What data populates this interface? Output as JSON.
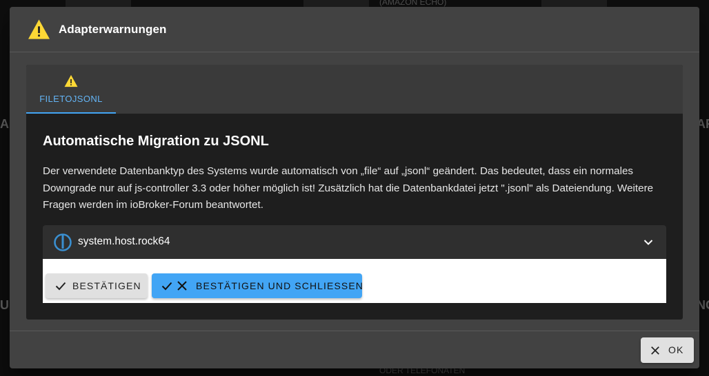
{
  "background": {
    "left_big": "AH",
    "left_big2": "UL",
    "right_big": "AR",
    "right_big2": "NG",
    "bottom_text": "ODER TELEFONATEN",
    "top_text": "(AMAZON ECHO)"
  },
  "dialog": {
    "title": "Adapterwarnungen",
    "tab_label": "FILETOJSONL",
    "heading": "Automatische Migration zu JSONL",
    "description": "Der verwendete Datenbanktyp des Systems wurde automatisch von „file“ auf „jsonl“ geändert. Das bedeutet, dass ein normales Downgrade nur auf js-controller 3.3 oder höher möglich ist! Zusätzlich hat die Datenbankdatei jetzt \".jsonl\" als Dateiendung. Weitere Fragen werden im ioBroker-Forum beantwortet.",
    "host_name": "system.host.rock64",
    "confirm_label": "BESTÄTIGEN",
    "confirm_close_label": "BESTÄTIGEN UND SCHLIESSEN",
    "ok_label": "OK"
  },
  "colors": {
    "accent": "#42a5f5",
    "warning": "#fdd835",
    "dialog_bg": "#424242",
    "content_bg": "#1e1e1e"
  },
  "icons": {
    "title_icon": "warning-icon",
    "tab_icon": "warning-icon",
    "host_icon": "iobroker-logo-icon",
    "expand_icon": "chevron-down-icon",
    "confirm_icon": "check-icon",
    "close_icon": "close-icon"
  }
}
